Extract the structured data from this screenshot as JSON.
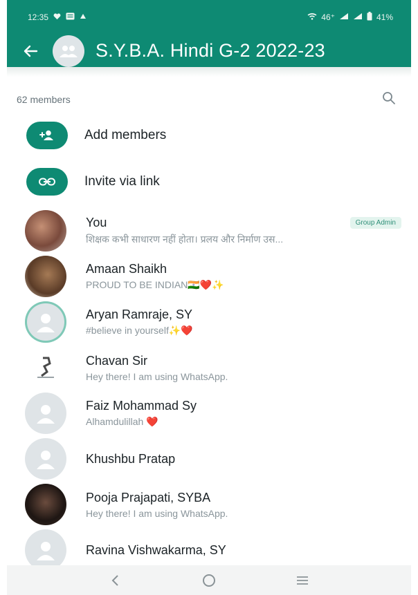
{
  "status_bar": {
    "time": "12:35",
    "right_text": "46⁺",
    "battery": "41%",
    "icons": [
      "heart-icon",
      "message-icon",
      "upload-icon",
      "wifi-icon",
      "signal-icon",
      "battery-icon"
    ]
  },
  "app_bar": {
    "back_icon": "back-arrow-icon",
    "title": "S.Y.B.A. Hindi  G-2 2022-23",
    "background": "#0e8a73"
  },
  "members": {
    "count_label": "62 members",
    "search_icon": "search-icon"
  },
  "actions": [
    {
      "label": "Add members",
      "icon": "add-person-icon"
    },
    {
      "label": "Invite via link",
      "icon": "link-icon"
    }
  ],
  "list": [
    {
      "name": "You",
      "status": "शिक्षक कभी साधारण नहीं होता। प्रलय और निर्माण उस...",
      "badge": "Group Admin"
    },
    {
      "name": "Amaan Shaikh",
      "status": "PROUD TO BE INDIAN🇮🇳❤️✨"
    },
    {
      "name": "Aryan Ramraje, SY",
      "status": "#believe in yourself✨❤️"
    },
    {
      "name": "Chavan Sir",
      "status": "Hey there! I am using WhatsApp."
    },
    {
      "name": "Faiz Mohammad Sy",
      "status": "Alhamdulillah ❤️"
    },
    {
      "name": "Khushbu Pratap",
      "status": ""
    },
    {
      "name": "Pooja Prajapati, SYBA",
      "status": "Hey there! I am using WhatsApp."
    },
    {
      "name": "Ravina Vishwakarma, SY",
      "status": ""
    }
  ],
  "nav_bar": {
    "icons": [
      "nav-back-icon",
      "nav-home-icon",
      "nav-recents-icon"
    ]
  },
  "colors": {
    "accent": "#0e8a73",
    "badge_text": "#2f8f78",
    "badge_bg": "#e3f4ee"
  }
}
